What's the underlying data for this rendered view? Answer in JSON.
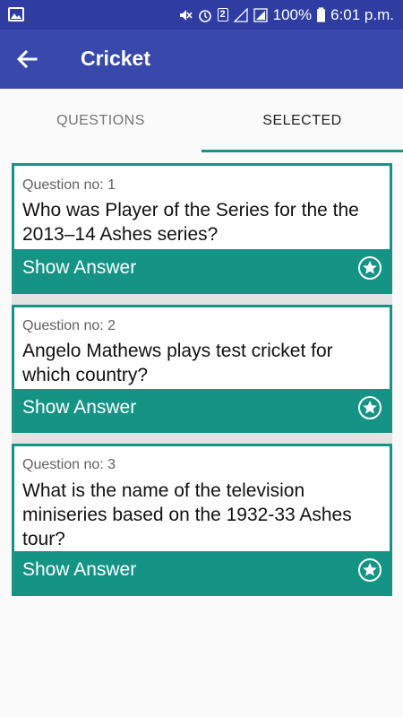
{
  "status_bar": {
    "battery_percent": "100%",
    "time": "6:01 p.m.",
    "sim_label": "2"
  },
  "app_bar": {
    "title": "Cricket",
    "back_icon": "arrow-left-icon"
  },
  "tabs": [
    {
      "label": "QUESTIONS",
      "selected": false
    },
    {
      "label": "SELECTED",
      "selected": true
    }
  ],
  "colors": {
    "primary": "#3949ab",
    "status_bar": "#2f3da3",
    "accent": "#159486"
  },
  "cards": [
    {
      "qnum": "Question no: 1",
      "qtext": "Who was Player of the Series for the the 2013–14 Ashes series?",
      "show_answer": "Show Answer",
      "star_icon": "star-circle-icon"
    },
    {
      "qnum": "Question no: 2",
      "qtext": "Angelo Mathews plays test cricket for which country?",
      "show_answer": "Show Answer",
      "star_icon": "star-circle-icon"
    },
    {
      "qnum": "Question no: 3",
      "qtext": "What is the name of the television miniseries based on the 1932-33 Ashes tour?",
      "show_answer": "Show Answer",
      "star_icon": "star-circle-icon"
    }
  ]
}
